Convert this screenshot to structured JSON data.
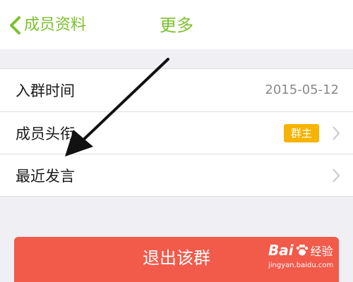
{
  "nav": {
    "back_label": "成员资料",
    "title": "更多"
  },
  "rows": [
    {
      "label": "入群时间",
      "value": "2015-05-12"
    },
    {
      "label": "成员头衔",
      "badge": "群主"
    },
    {
      "label": "最近发言"
    }
  ],
  "actions": {
    "exit_label": "退出该群"
  },
  "watermark": {
    "brand": "Bai",
    "brand_cn": "经验",
    "url": "jingyan.baidu.com"
  },
  "colors": {
    "accent": "#7cc12e",
    "badge": "#f5b400",
    "danger": "#f25a4a",
    "background": "#efeff4"
  }
}
